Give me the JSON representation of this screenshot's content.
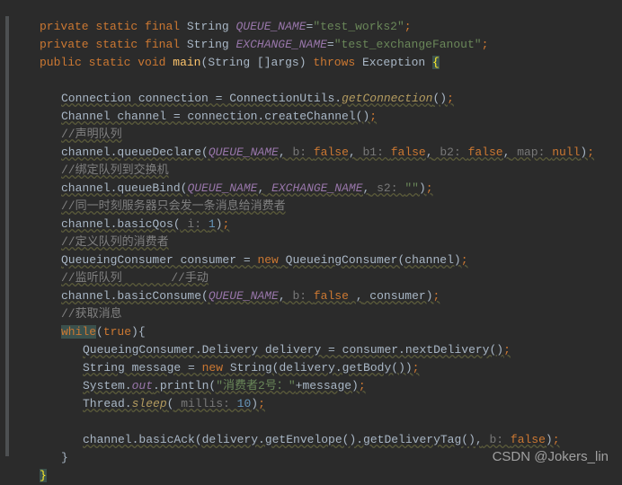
{
  "lines": {
    "l1_kw1": "private",
    "l1_kw2": "static",
    "l1_kw3": "final",
    "l1_type": "String",
    "l1_var": "QUEUE_NAME",
    "l1_eq": "=",
    "l1_str": "\"test_works2\"",
    "l1_semi": ";",
    "l2_kw1": "private",
    "l2_kw2": "static",
    "l2_kw3": "final",
    "l2_type": "String",
    "l2_var": "EXCHANGE_NAME",
    "l2_eq": "=",
    "l2_str": "\"test_exchangeFanout\"",
    "l2_semi": ";",
    "l3_kw1": "public",
    "l3_kw2": "static",
    "l3_kw3": "void",
    "l3_method": "main",
    "l3_paren_o": "(",
    "l3_p1": "String []args",
    "l3_paren_c": ")",
    "l3_throws": "throws",
    "l3_exc": "Exception",
    "l3_brace": "{",
    "l5_text": "Connection connection = ConnectionUtils.",
    "l5_method": "getConnection",
    "l5_pc": "()",
    "l5_semi": ";",
    "l6_text": "Channel channel = connection.createChannel()",
    "l6_semi": ";",
    "l7_comment": "//声明队列",
    "l8_text": "channel.queueDeclare(",
    "l8_var": "QUEUE_NAME",
    "l8_c1": ",",
    "l8_h1": " b: ",
    "l8_v1": "false",
    "l8_c2": ",",
    "l8_h2": " b1: ",
    "l8_v2": "false",
    "l8_c3": ",",
    "l8_h3": " b2: ",
    "l8_v3": "false",
    "l8_c4": ",",
    "l8_h4": " map: ",
    "l8_v4": "null",
    "l8_pc": ")",
    "l8_semi": ";",
    "l9_comment": "//绑定队列到交换机",
    "l10_text": "channel.queueBind(",
    "l10_var1": "QUEUE_NAME",
    "l10_c1": ",",
    "l10_var2": "EXCHANGE_NAME",
    "l10_c2": ",",
    "l10_h1": " s2: ",
    "l10_str": "\"\"",
    "l10_pc": ")",
    "l10_semi": ";",
    "l11_comment": "//同一时刻服务器只会发一条消息给消费者",
    "l12_text": "channel.basicQos(",
    "l12_h1": " i: ",
    "l12_num": "1",
    "l12_pc": ")",
    "l12_semi": ";",
    "l13_comment": "//定义队列的消费者",
    "l14_text": "QueueingConsumer consumer = ",
    "l14_new": "new",
    "l14_ctor": " QueueingConsumer(channel)",
    "l14_semi": ";",
    "l15_c1": "//监听队列",
    "l15_sp": "       ",
    "l15_c2": "//手动",
    "l16_text": "channel.basicConsume(",
    "l16_var": "QUEUE_NAME",
    "l16_c1": ",",
    "l16_h1": " b: ",
    "l16_v1": "false",
    "l16_c2": " ,",
    "l16_arg": " consumer)",
    "l16_semi": ";",
    "l17_comment": "//获取消息",
    "l18_while": "while",
    "l18_po": "(",
    "l18_true": "true",
    "l18_pc": ")",
    "l18_brace": "{",
    "l19_text": "QueueingConsumer.Delivery delivery = consumer.nextDelivery()",
    "l19_semi": ";",
    "l20_text": "String message = ",
    "l20_new": "new",
    "l20_rest": " String(delivery.getBody())",
    "l20_semi": ";",
    "l21_sys": "System.",
    "l21_out": "out",
    "l21_dot": ".println(",
    "l21_str": "\"消费者2号：\"",
    "l21_plus": "+message)",
    "l21_semi": ";",
    "l22_thr": "Thread.",
    "l22_sleep": "sleep",
    "l22_po": "(",
    "l22_h1": " millis: ",
    "l22_num": "10",
    "l22_pc": ")",
    "l22_semi": ";",
    "l24_text": "channel.basicAck(delivery.getEnvelope().getDeliveryTag(),",
    "l24_h1": " b: ",
    "l24_v1": "false",
    "l24_pc": ")",
    "l24_semi": ";",
    "l25_brace": "}",
    "l26_brace": "}"
  },
  "watermark": "CSDN @Jokers_lin"
}
